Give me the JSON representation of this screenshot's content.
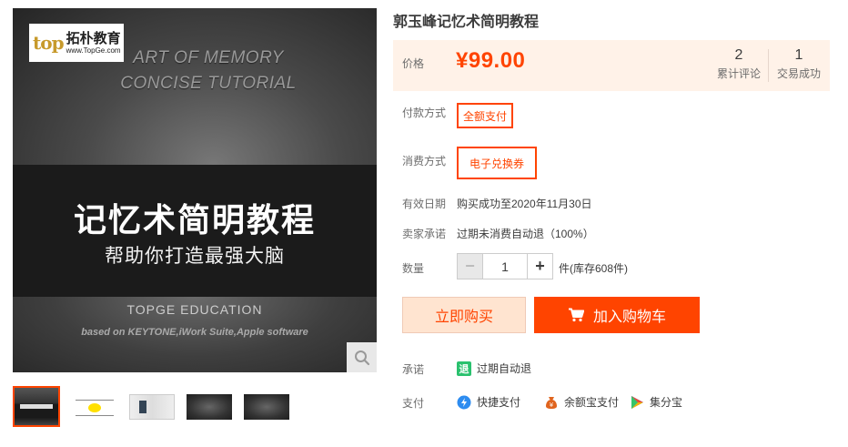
{
  "product": {
    "title": "郭玉峰记忆术简明教程",
    "price_label": "价格",
    "price": "¥99.00",
    "stats": [
      {
        "num": "2",
        "label": "累计评论"
      },
      {
        "num": "1",
        "label": "交易成功"
      }
    ]
  },
  "image": {
    "logo_mark": "top",
    "logo_cn": "拓朴教育",
    "logo_url": "www.TopGe.com",
    "en_line1": "ART OF MEMORY",
    "en_line2": "CONCISE TUTORIAL",
    "cn_title": "记忆术简明教程",
    "cn_subtitle": "帮助你打造最强大脑",
    "brand": "TOPGE EDUCATION",
    "based_on": "based on KEYTONE,iWork Suite,Apple software",
    "thumbnail_count": 5,
    "active_thumbnail": 1
  },
  "options": {
    "pay_label": "付款方式",
    "pay_value": "全额支付",
    "consume_label": "消费方式",
    "consume_value": "电子兑换券",
    "valid_label": "有效日期",
    "valid_value": "购买成功至2020年11月30日",
    "promise_label": "卖家承诺",
    "promise_value": "过期未消费自动退（100%）",
    "qty_label": "数量",
    "qty_minus": "−",
    "qty_value": "1",
    "qty_plus": "+",
    "stock": "件(库存608件)"
  },
  "actions": {
    "buy_now": "立即购买",
    "add_cart": "加入购物车"
  },
  "services": {
    "guarantee_label": "承诺",
    "guarantee_icon_text": "退",
    "guarantee_value": "过期自动退",
    "payment_label": "支付",
    "payments": [
      "快捷支付",
      "余额宝支付",
      "集分宝"
    ]
  },
  "colors": {
    "accent": "#ff4400",
    "price_bg": "#fff2e8",
    "buy_bg": "#ffe4d0",
    "refund_green": "#2ac16e"
  }
}
